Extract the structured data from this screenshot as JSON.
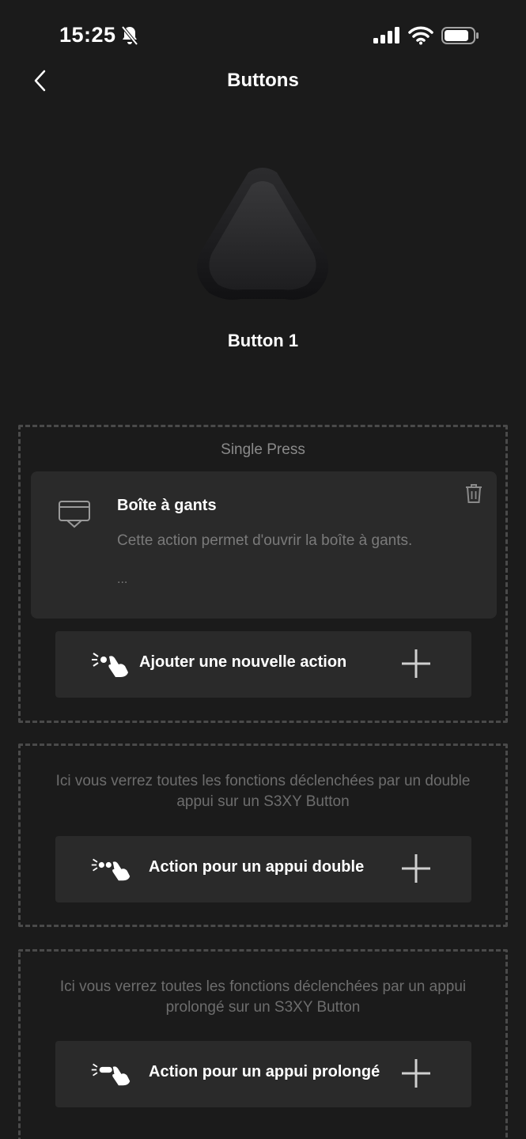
{
  "status": {
    "time": "15:25"
  },
  "nav": {
    "title": "Buttons"
  },
  "device": {
    "label": "Button 1"
  },
  "single": {
    "title": "Single Press",
    "card": {
      "title": "Boîte à gants",
      "description": "Cette action permet d'ouvrir la boîte à gants.",
      "more": "..."
    },
    "add_label": "Ajouter une nouvelle action"
  },
  "double": {
    "info": "Ici vous verrez toutes les fonctions déclenchées par un double appui sur un S3XY Button",
    "add_label": "Action pour un appui double"
  },
  "long": {
    "info": "Ici vous verrez toutes les fonctions déclenchées par un appui prolongé sur un S3XY Button",
    "add_label": "Action pour un appui prolongé"
  },
  "colors": {
    "background": "#1b1b1b",
    "card": "#2a2a2a",
    "dashed": "#4a4a4a"
  }
}
